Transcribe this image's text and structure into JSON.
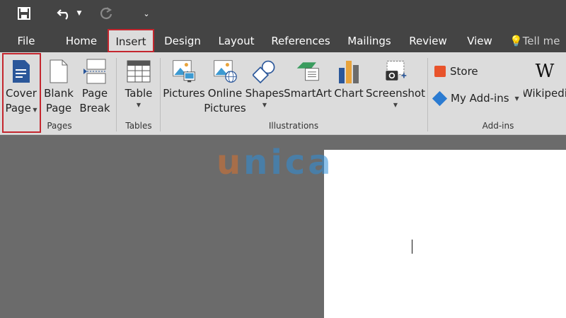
{
  "qat": {
    "save_icon": "save-icon",
    "undo_icon": "undo-icon",
    "redo_icon": "redo-icon",
    "customize_icon": "customize-qat-icon"
  },
  "tabs": {
    "file": "File",
    "home": "Home",
    "insert": "Insert",
    "design": "Design",
    "layout": "Layout",
    "references": "References",
    "mailings": "Mailings",
    "review": "Review",
    "view": "View",
    "tellme": "Tell me"
  },
  "ribbon": {
    "pages": {
      "group_label": "Pages",
      "cover_page_1": "Cover",
      "cover_page_2": "Page",
      "blank_page_1": "Blank",
      "blank_page_2": "Page",
      "page_break_1": "Page",
      "page_break_2": "Break"
    },
    "tables": {
      "group_label": "Tables",
      "table": "Table"
    },
    "illustrations": {
      "group_label": "Illustrations",
      "pictures": "Pictures",
      "online_pictures_1": "Online",
      "online_pictures_2": "Pictures",
      "shapes": "Shapes",
      "smartart": "SmartArt",
      "chart": "Chart",
      "screenshot": "Screenshot"
    },
    "addins": {
      "group_label": "Add-ins",
      "store": "Store",
      "my_addins": "My Add-ins",
      "wikipedia": "Wikipedi"
    }
  },
  "watermark": {
    "letters": [
      "u",
      "n",
      "i",
      "c",
      "a"
    ],
    "colors": [
      "#d9722f",
      "#2f8fd9",
      "#2f8fd9",
      "#2f8fd9",
      "#2f8fd9"
    ]
  },
  "colors": {
    "highlight": "#c4262e",
    "dark_bar": "#444444",
    "ribbon_bg": "#dcdcdc",
    "canvas_bg": "#6b6b6b"
  }
}
